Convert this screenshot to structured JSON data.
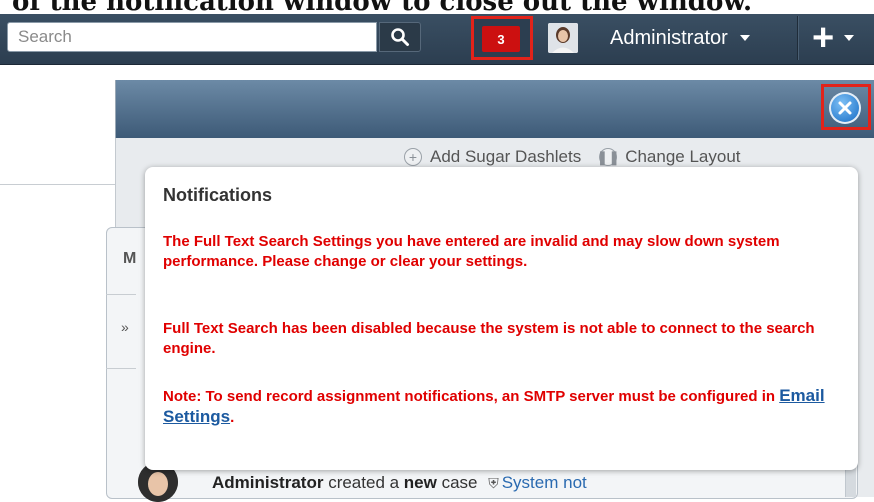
{
  "caption": {
    "text": "of the notification window to close out the window."
  },
  "topbar": {
    "search_placeholder": "Search",
    "notification_count": "3",
    "user_name": "Administrator"
  },
  "panel": {
    "add_dashlets_label": "Add Sugar Dashlets",
    "change_layout_label": "Change Layout"
  },
  "dashlet": {
    "partial_header": "M",
    "feed": {
      "user": "Administrator",
      "text_1": " created a ",
      "bold_word": "new",
      "text_2": " case ",
      "link": "System not"
    }
  },
  "notifications": {
    "title": "Notifications",
    "messages": [
      "The Full Text Search Settings you have entered are invalid and may slow down system performance. Please change or clear your settings.",
      "Full Text Search has been disabled because the system is not able to connect to the search engine."
    ],
    "smtp_prefix": "Note: To send record assignment notifications, an SMTP server must be configured in ",
    "smtp_link": "Email Settings",
    "smtp_suffix": "."
  },
  "colors": {
    "highlight_border": "#e2231a",
    "notification_text": "#e00000",
    "link": "#1c5aa0",
    "topbar": "#2c3e50"
  }
}
